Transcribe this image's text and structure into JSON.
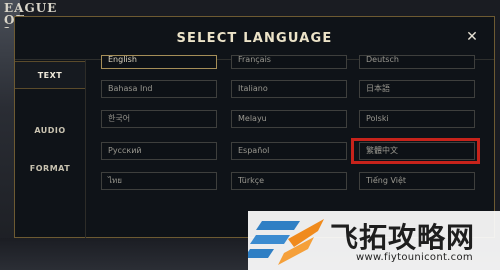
{
  "background": {
    "logo_text": "EAGUE OF LEGENDS"
  },
  "dialog": {
    "title": "SELECT LANGUAGE",
    "close_symbol": "✕",
    "tabs": [
      {
        "label": "TEXT",
        "active": true
      },
      {
        "label": "AUDIO",
        "active": false
      },
      {
        "label": "FORMAT",
        "active": false
      }
    ],
    "languages": [
      {
        "label": "English",
        "selected": true
      },
      {
        "label": "Français",
        "selected": false
      },
      {
        "label": "Deutsch",
        "selected": false
      },
      {
        "label": "Bahasa Ind",
        "selected": false
      },
      {
        "label": "Italiano",
        "selected": false
      },
      {
        "label": "日本語",
        "selected": false
      },
      {
        "label": "한국어",
        "selected": false
      },
      {
        "label": "Melayu",
        "selected": false
      },
      {
        "label": "Polski",
        "selected": false
      },
      {
        "label": "Русский",
        "selected": false
      },
      {
        "label": "Español",
        "selected": false
      },
      {
        "label": "繁體中文",
        "selected": false,
        "highlighted": true
      },
      {
        "label": "ไทย",
        "selected": false
      },
      {
        "label": "Türkçe",
        "selected": false
      },
      {
        "label": "Tiếng Việt",
        "selected": false
      }
    ],
    "highlight_color": "#c7231b",
    "accent_color": "#a58e58"
  },
  "watermark": {
    "text": "飞拓攻略网",
    "url": "www.fiytounicont.com",
    "colors": {
      "blue": "#2f7fc4",
      "orange": "#f08a1c"
    }
  }
}
